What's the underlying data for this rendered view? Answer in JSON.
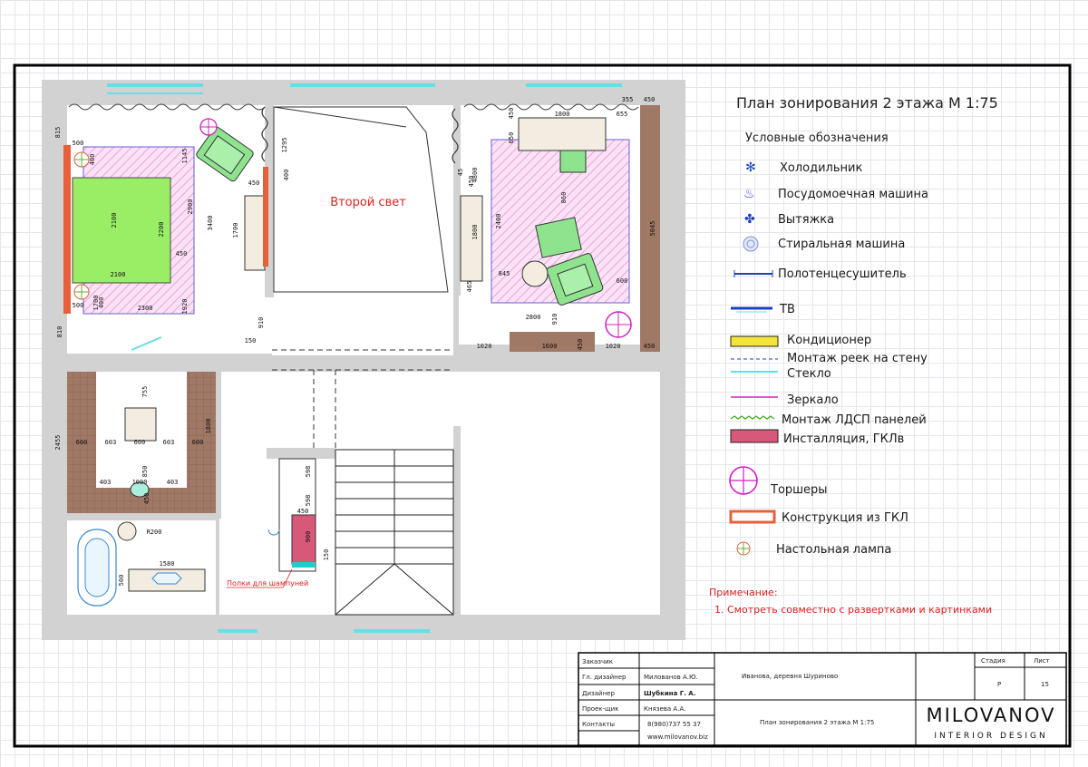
{
  "legend": {
    "title": "План зонирования 2  этажа М 1:75",
    "subtitle": "Условные обозначения",
    "items": [
      {
        "key": "fridge",
        "label": "Холодильник"
      },
      {
        "key": "dishwasher",
        "label": "Посудомоечная машина"
      },
      {
        "key": "hood",
        "label": "Вытяжка"
      },
      {
        "key": "washer",
        "label": "Стиральная машина"
      },
      {
        "key": "towel",
        "label": "Полотенцесушитель"
      },
      {
        "key": "tv",
        "label": "ТВ"
      },
      {
        "key": "ac",
        "label": "Кондиционер"
      },
      {
        "key": "rails",
        "label": "Монтаж реек на стену"
      },
      {
        "key": "glass",
        "label": "Стекло"
      },
      {
        "key": "mirror",
        "label": "Зеркало"
      },
      {
        "key": "ldsp",
        "label": "Монтаж ЛДСП панелей"
      },
      {
        "key": "install",
        "label": "Инсталляция, ГКЛв"
      },
      {
        "key": "floorlamp",
        "label": "Торшеры"
      },
      {
        "key": "gkl",
        "label": "Конструкция из ГКЛ"
      },
      {
        "key": "desklamp",
        "label": "Настольная лампа"
      }
    ],
    "note_title": "Примечание:",
    "note_text": "1. Смотреть совместно с развертками и картинками"
  },
  "plan": {
    "double_height_label": "Второй свет",
    "shelves_note": "Полки для шампуней",
    "colors": {
      "wall": "#d2d2d2",
      "bed": "#99ee66",
      "chair": "#8fe38f",
      "hatch": "#f0a0e0",
      "wood": "#a07866",
      "glass": "#66e0e8",
      "install": "#d8587a",
      "gkl": "#e8603a",
      "dim": "#2222cc"
    },
    "dimensions": {
      "bedroom_left": [
        "815",
        "500",
        "400",
        "1145",
        "2100",
        "2100",
        "2200",
        "450",
        "2900",
        "3400",
        "500",
        "1700",
        "2300",
        "1920",
        "810",
        "400",
        "450",
        "1295",
        "400",
        "1700",
        "910",
        "150"
      ],
      "bedroom_right": [
        "355",
        "450",
        "1800",
        "655",
        "450",
        "650",
        "45",
        "450",
        "4800",
        "860",
        "2400",
        "1800",
        "845",
        "465",
        "600",
        "5045",
        "2800",
        "910",
        "1020",
        "1600",
        "450",
        "1020",
        "450"
      ],
      "bathroom": [
        "2455",
        "600",
        "603",
        "600",
        "603",
        "600",
        "755",
        "1800",
        "403",
        "1000",
        "403",
        "850",
        "450",
        "R200",
        "1580",
        "500",
        "598",
        "598",
        "450",
        "900",
        "150"
      ]
    }
  },
  "title_block": {
    "rows": [
      {
        "label": "Заказчик",
        "value": ""
      },
      {
        "label": "Гл. дизайнер",
        "value": "Милованов А.Ю."
      },
      {
        "label": "Дизайнер",
        "value": "Шубкина Г. А."
      },
      {
        "label": "Проек-щик",
        "value": "Князева А.А."
      },
      {
        "label": "Контакты",
        "value": "8(980)737 55 37"
      }
    ],
    "website": "www.milovanov.biz",
    "object": "Иванова, деревня Шуриново",
    "sheet_name": "План зонирования 2  этажа М 1:75",
    "stage_label": "Стадия",
    "stage_value": "Р",
    "sheet_label": "Лист",
    "sheet_value": "15",
    "brand": "MILOVANOV",
    "brand_sub": "INTERIOR DESIGN"
  }
}
